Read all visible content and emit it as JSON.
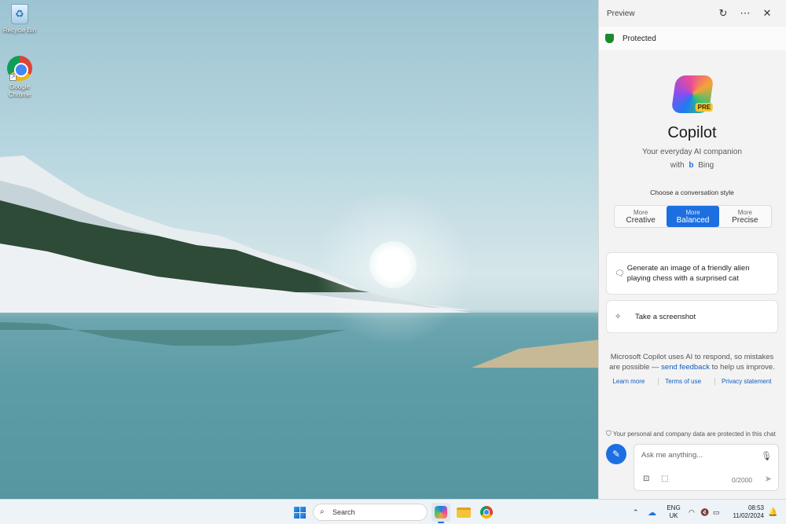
{
  "desktop": {
    "icons": [
      {
        "label": "Recycle Bin",
        "icon": "recycle-bin-icon"
      },
      {
        "label": "Google Chrome",
        "icon": "chrome-icon"
      }
    ]
  },
  "panel": {
    "header_title": "Preview",
    "status": "Protected",
    "brand_badge": "PRE",
    "title": "Copilot",
    "subtitle": "Your everyday AI companion",
    "with_label": "with",
    "bing_label": "Bing",
    "style_prompt": "Choose a conversation style",
    "styles": [
      {
        "small": "More",
        "big": "Creative",
        "active": false
      },
      {
        "small": "More",
        "big": "Balanced",
        "active": true
      },
      {
        "small": "More",
        "big": "Precise",
        "active": false
      }
    ],
    "suggestions": [
      {
        "text": "Generate an image of a friendly alien playing chess with a surprised cat",
        "icon": "image-chat-icon"
      },
      {
        "text": "Take a screenshot",
        "icon": "sparkle-icon"
      }
    ],
    "disclaimer_pre": "Microsoft Copilot uses AI to respond, so mistakes are possible — ",
    "disclaimer_link": "send feedback",
    "disclaimer_post": " to help us improve.",
    "links": [
      "Learn more",
      "Terms of use",
      "Privacy statement"
    ],
    "privacy_note": "Your personal and company data are protected in this chat",
    "input_placeholder": "Ask me anything...",
    "char_counter": "0/2000"
  },
  "taskbar": {
    "search_placeholder": "Search",
    "lang_top": "ENG",
    "lang_bottom": "UK",
    "time": "08:53",
    "date": "11/02/2024"
  },
  "colors": {
    "accent": "#1c6fe0",
    "protected_green": "#1a8a2c",
    "link": "#0f5cc0"
  }
}
